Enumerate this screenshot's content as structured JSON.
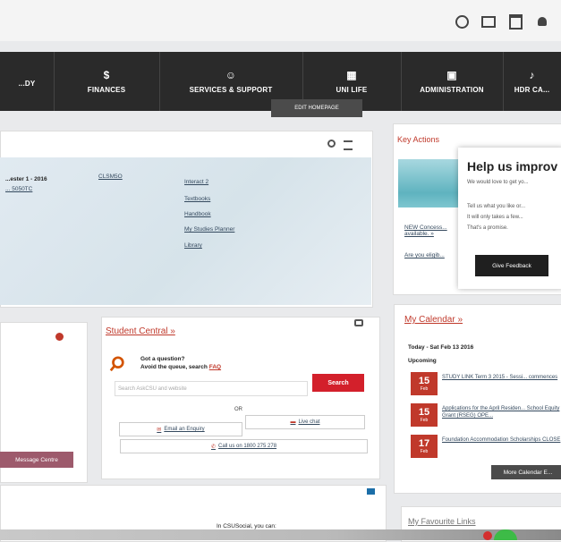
{
  "topbar": {
    "icons": [
      "lightbulb-icon",
      "mail-icon",
      "calendar-icon",
      "user-icon"
    ]
  },
  "nav": {
    "items": [
      {
        "label": "...DY",
        "icon": ""
      },
      {
        "label": "FINANCES",
        "icon": "$"
      },
      {
        "label": "SERVICES & SUPPORT",
        "icon": "☺"
      },
      {
        "label": "UNI LIFE",
        "icon": "▦"
      },
      {
        "label": "ADMINISTRATION",
        "icon": "▣"
      },
      {
        "label": "HDR CA...",
        "icon": "♪"
      }
    ]
  },
  "edit_homepage_label": "EDIT HOMEPAGE",
  "left_panel": {
    "semester": "...ester 1 - 2016",
    "sub": "... 5050TC",
    "col2": "CLSM5O",
    "links": [
      "Interact 2",
      "Textbooks",
      "Handbook",
      "My Studies Planner",
      "Library"
    ]
  },
  "key_actions": {
    "title": "Key Actions",
    "link1": "NEW Concess... available. »",
    "link2": "Are you eligib..."
  },
  "feedback": {
    "title": "Help us improv",
    "line1": "We would love to get yo...",
    "line2": "Tell us what you like or...",
    "line3": "It will only takes a few...",
    "line4": "That's a promise.",
    "button": "Give Feedback"
  },
  "left_mid": {
    "button": "Message Centre"
  },
  "student_central": {
    "title": "Student Central »",
    "question": "Got a question?",
    "sub": "Avoid the queue, search ",
    "sub_tag": "FAQ",
    "search_placeholder": "Search AskCSU and website",
    "search_button": "Search",
    "or": "OR",
    "email": "Email an Enquiry",
    "chat": "Live chat",
    "call": "Call us on 1800 275 278"
  },
  "calendar": {
    "title": "My Calendar »",
    "range": "Today - Sat Feb 13 2016",
    "upcoming": "Upcoming",
    "events": [
      {
        "day": "15",
        "mon": "Feb",
        "text": "STUDY LINK Term 3 2015 - Sessi... commences"
      },
      {
        "day": "15",
        "mon": "Feb",
        "text": "Applications for the April Residen... School Equity Grant (RSEG) OPE..."
      },
      {
        "day": "17",
        "mon": "Feb",
        "text": "Foundation Accommodation Scholarships CLOSE"
      }
    ],
    "more_button": "More Calendar E..."
  },
  "bottom": {
    "social_text": "In CSUSocial, you can:"
  },
  "favourites": {
    "title": "My Favourite Links"
  }
}
